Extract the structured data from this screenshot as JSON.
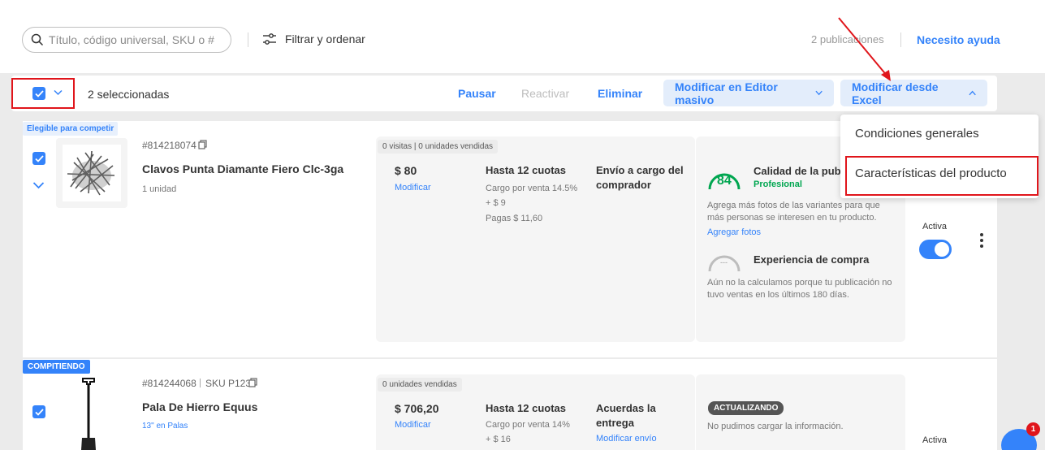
{
  "header": {
    "search_placeholder": "Título, código universal, SKU o #",
    "filter_label": "Filtrar y ordenar",
    "publications_count": "2 publicaciones",
    "help_link": "Necesito ayuda"
  },
  "actionbar": {
    "selected_count": "2 seleccionadas",
    "pause": "Pausar",
    "reactivate": "Reactivar",
    "delete": "Eliminar",
    "bulk_editor": "Modificar en Editor masivo",
    "excel": "Modificar desde Excel"
  },
  "dropdown": {
    "items": [
      "Condiciones generales",
      "Características del producto"
    ]
  },
  "products": [
    {
      "badge": "Elegible para competir",
      "id": "#814218074",
      "title": "Clavos Punta Diamante Fiero Clc-3ga",
      "subtitle": "1 unidad",
      "stats": "0 visitas | 0 unidades vendidas",
      "price": "$ 80",
      "price_action": "Modificar",
      "installments": "Hasta 12 cuotas",
      "fee_line1": "Cargo por venta 14.5%",
      "fee_line2": "+ $ 9",
      "fee_line3": "Pagas $ 11,60",
      "shipping": "Envío a cargo del comprador",
      "quality_title": "Calidad de la pub",
      "quality_score": "84",
      "quality_level": "Profesional",
      "quality_desc": "Agrega más fotos de las variantes para que más personas se interesen en tu producto.",
      "quality_action": "Agregar fotos",
      "experience_title": "Experiencia de compra",
      "experience_desc": "Aún no la calculamos porque tu publicación no tuvo ventas en los últimos 180 días.",
      "experience_gauge": "---",
      "status": "Activa"
    },
    {
      "badge": "COMPITIENDO",
      "id": "#814244068",
      "sku": "SKU P123",
      "title": "Pala De Hierro Equus",
      "subtitle": "13\" en Palas",
      "stats": "0 unidades vendidas",
      "price": "$ 706,20",
      "price_action": "Modificar",
      "installments": "Hasta 12 cuotas",
      "fee_line1": "Cargo por venta 14%",
      "fee_line2": "+ $ 16",
      "shipping": "Acuerdas la entrega",
      "shipping_action": "Modificar envío",
      "update_badge": "ACTUALIZANDO",
      "update_desc": "No pudimos cargar la información.",
      "status": "Activa"
    }
  ],
  "notification_count": "1",
  "colors": {
    "accent": "#3483fa",
    "annotation": "#e0151b",
    "quality_green": "#00a650"
  }
}
